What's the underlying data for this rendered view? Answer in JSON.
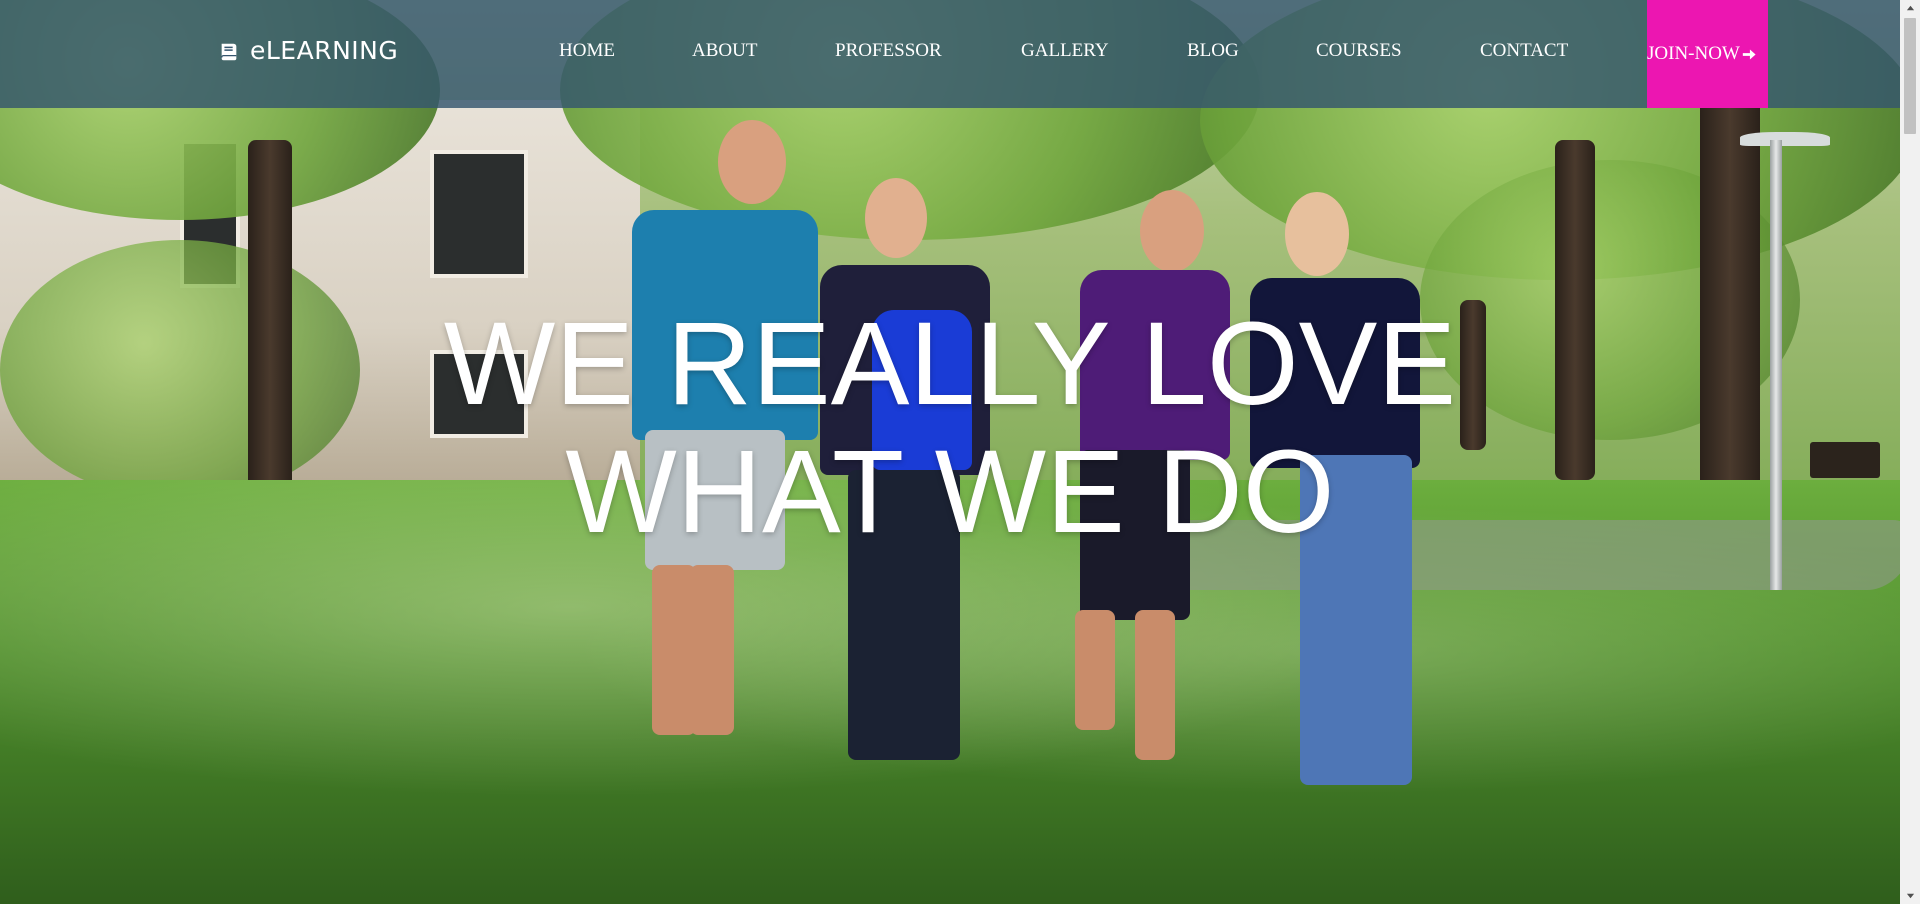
{
  "header": {
    "logo_text": "eLEARNING",
    "logo_icon": "book-icon",
    "nav": [
      {
        "label": "HOME"
      },
      {
        "label": "ABOUT"
      },
      {
        "label": "PROFESSOR"
      },
      {
        "label": "GALLERY"
      },
      {
        "label": "BLOG"
      },
      {
        "label": "COURSES"
      },
      {
        "label": "CONTACT"
      }
    ],
    "join": {
      "label": "JOIN-NOW",
      "icon": "arrow-right-icon"
    }
  },
  "hero": {
    "headline_line1": "WE REALLY LOVE",
    "headline_line2": "WHAT WE DO"
  },
  "colors": {
    "header_bg": "#35556e",
    "join_bg": "#ec16b1",
    "text": "#ffffff"
  }
}
